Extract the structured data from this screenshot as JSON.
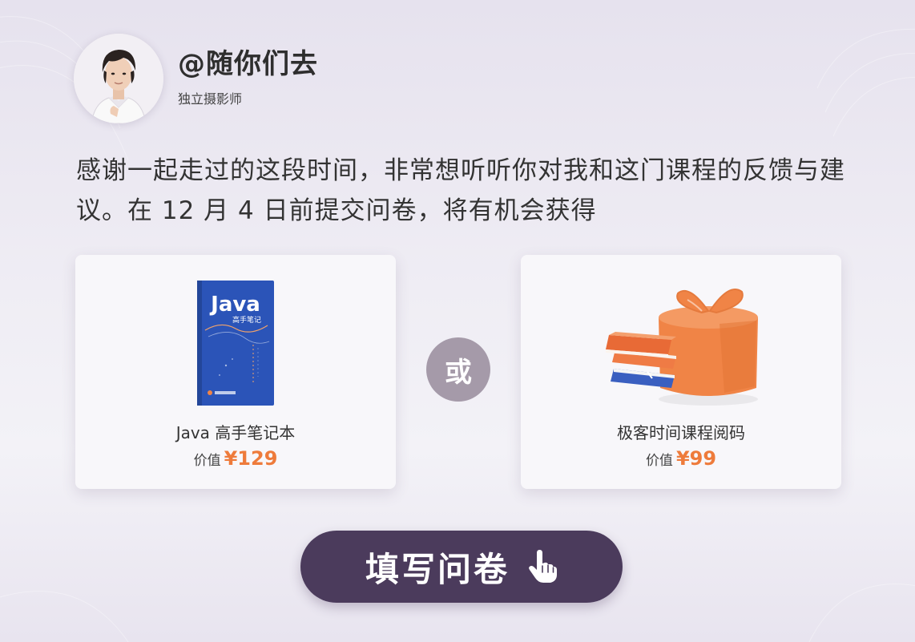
{
  "profile": {
    "username": "@随你们去",
    "role": "独立摄影师"
  },
  "message": {
    "text": "感谢一起走过的这段时间，非常想听听你对我和这门课程的反馈与建议。在 12 月 4 日前提交问卷，将有机会获得"
  },
  "rewards": [
    {
      "title": "Java 高手笔记本",
      "price_label": "价值",
      "price_value": "¥129",
      "image": {
        "cover_title": "Java",
        "cover_subtitle": "高手笔记"
      }
    },
    {
      "title": "极客时间课程阅码",
      "price_label": "价值",
      "price_value": "¥99"
    }
  ],
  "divider": {
    "or_label": "或"
  },
  "cta": {
    "label": "填写问卷",
    "icon": "hand-pointer-icon"
  },
  "colors": {
    "accent": "#ee7b3b",
    "button_bg": "#4b3b5c",
    "book_blue": "#2b54b8",
    "gift_orange": "#f08446",
    "or_circle": "#a59aa9"
  }
}
